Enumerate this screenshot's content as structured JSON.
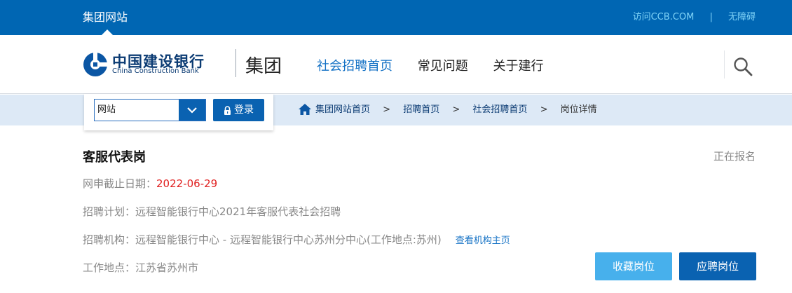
{
  "topbar": {
    "group_site": "集团网站",
    "visit_ccb": "访问CCB.COM",
    "separator": "|",
    "accessibility": "无障碍"
  },
  "header": {
    "logo_cn": "中国建设银行",
    "logo_en": "China Construction Bank",
    "logo_group": "集团",
    "nav": [
      "社会招聘首页",
      "常见问题",
      "关于建行"
    ]
  },
  "site_selector": {
    "value": "网站",
    "login_label": "登录"
  },
  "breadcrumb": {
    "items": [
      "集团网站首页",
      "招聘首页",
      "社会招聘首页",
      "岗位详情"
    ],
    "arrow": ">"
  },
  "job": {
    "title": "客服代表岗",
    "status": "正在报名",
    "deadline_label": "网申截止日期：",
    "deadline": "2022-06-29",
    "plan_label": "招聘计划：",
    "plan": "远程智能银行中心2021年客服代表社会招聘",
    "org_label": "招聘机构：",
    "org": "远程智能银行中心 - 远程智能银行中心苏州分中心(工作地点:苏州)",
    "org_link": "查看机构主页",
    "location_label": "工作地点：",
    "location": "江苏省苏州市"
  },
  "actions": {
    "favorite": "收藏岗位",
    "apply": "应聘岗位"
  },
  "colors": {
    "brand_blue": "#0066b3",
    "link_blue": "#1572c5",
    "deadline_red": "#e02020",
    "fav_button": "#47b0ec"
  }
}
